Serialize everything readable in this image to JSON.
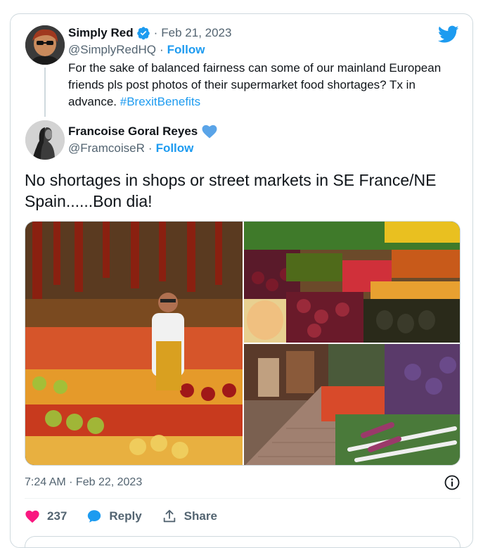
{
  "parent": {
    "name": "Simply Red",
    "date": "Feb 21, 2023",
    "handle": "@SimplyRedHQ",
    "follow": "Follow",
    "separator": "·",
    "text": "For the sake of balanced fairness can some of our mainland European friends pls post photos of their supermarket food shortages? Tx in advance.",
    "hashtag": "#BrexitBenefits"
  },
  "tweet": {
    "name": "Francoise Goral Reyes",
    "handle": "@FramcoiseR",
    "follow": "Follow",
    "separator": "·",
    "text": "No shortages in shops or street markets in SE France/NE Spain......Bon dia!",
    "timestamp": "7:24 AM · Feb 22, 2023"
  },
  "actions": {
    "like_count": "237",
    "reply_label": "Reply",
    "share_label": "Share"
  },
  "colors": {
    "accent": "#1d9bf0",
    "like": "#f91880",
    "muted": "#536471"
  },
  "icons": {
    "logo": "twitter-bird-icon",
    "verified": "verified-badge-icon",
    "heart_badge": "blue-heart-icon",
    "info": "info-icon",
    "like": "heart-icon",
    "reply": "reply-bubble-icon",
    "share": "share-upload-icon"
  }
}
